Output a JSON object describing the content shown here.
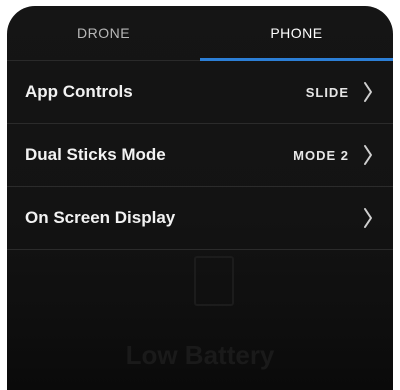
{
  "tabs": [
    {
      "label": "DRONE",
      "active": false
    },
    {
      "label": "PHONE",
      "active": true
    }
  ],
  "rows": [
    {
      "label": "App Controls",
      "value": "SLIDE"
    },
    {
      "label": "Dual Sticks Mode",
      "value": "MODE 2"
    },
    {
      "label": "On Screen Display",
      "value": ""
    }
  ],
  "background": {
    "message": "Low Battery"
  },
  "colors": {
    "accent": "#2c7fd6",
    "panel": "#141414"
  }
}
